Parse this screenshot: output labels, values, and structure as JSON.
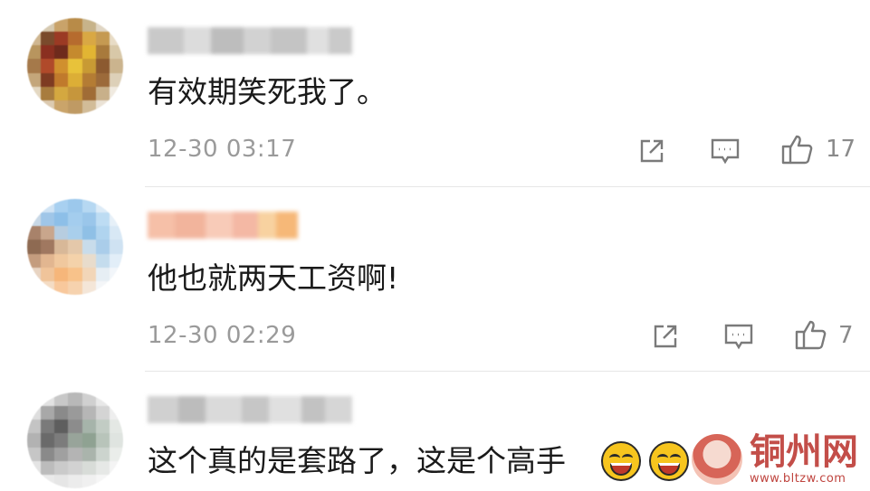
{
  "comments": [
    {
      "text": "有效期笑死我了。",
      "time": "12-30 03:17",
      "likes": "17"
    },
    {
      "text": "他也就两天工资啊!",
      "time": "12-30 02:29",
      "likes": "7"
    },
    {
      "text": "这个真的是套路了，这是个高手"
    }
  ],
  "icons": {
    "share": "share-icon",
    "comment": "comment-icon",
    "like": "thumbs-up-icon",
    "emoji": "grinning-emoji"
  },
  "watermark": {
    "title": "铜州网",
    "url": "www.bltzw.com"
  },
  "colors": {
    "text": "#1a1a1a",
    "meta": "#9a9a9a",
    "icon": "#7a7a7a",
    "watermark": "#b9302a"
  }
}
